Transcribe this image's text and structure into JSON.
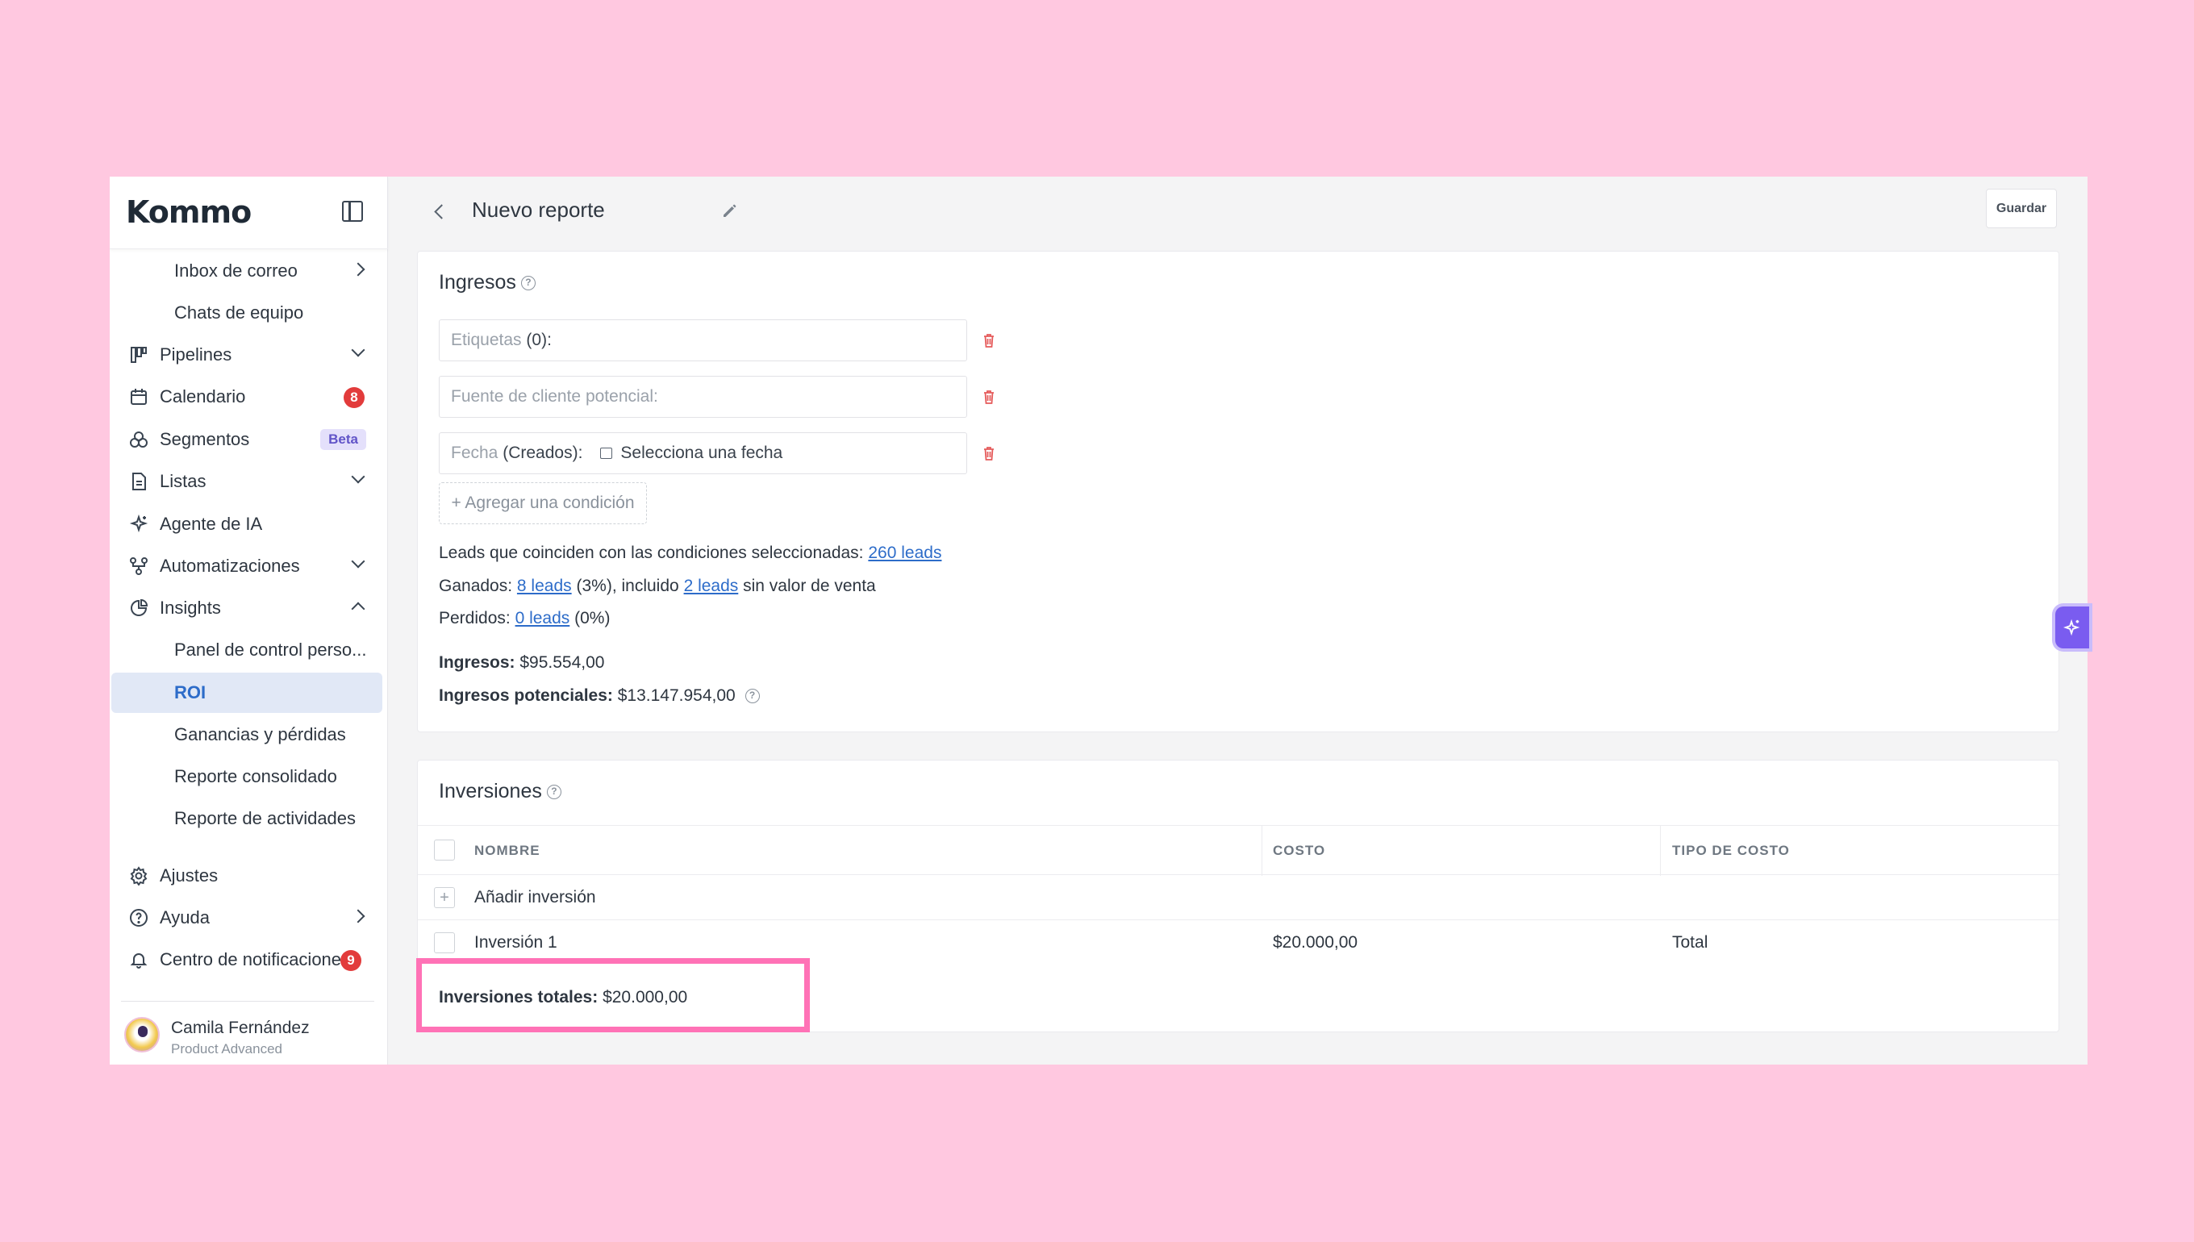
{
  "app": {
    "logo": "Kommo"
  },
  "sidebar": {
    "items": [
      {
        "label": "Inbox de correo",
        "icon": "none",
        "chevron": "right",
        "sub": true
      },
      {
        "label": "Chats de equipo",
        "icon": "none",
        "sub": true
      },
      {
        "label": "Pipelines",
        "icon": "pipelines-icon",
        "chevron": "down"
      },
      {
        "label": "Calendario",
        "icon": "calendar-icon",
        "badge": "8"
      },
      {
        "label": "Segmentos",
        "icon": "segments-icon",
        "beta": "Beta"
      },
      {
        "label": "Listas",
        "icon": "lists-icon",
        "chevron": "down"
      },
      {
        "label": "Agente de IA",
        "icon": "sparkle-icon"
      },
      {
        "label": "Automatizaciones",
        "icon": "automation-icon",
        "chevron": "down"
      },
      {
        "label": "Insights",
        "icon": "insights-icon",
        "chevron": "up"
      },
      {
        "label": "Panel de control perso...",
        "sub": true
      },
      {
        "label": "ROI",
        "sub": true,
        "active": true
      },
      {
        "label": "Ganancias y pérdidas",
        "sub": true
      },
      {
        "label": "Reporte consolidado",
        "sub": true
      },
      {
        "label": "Reporte de actividades",
        "sub": true
      }
    ],
    "bottom": [
      {
        "label": "Ajustes",
        "icon": "gear-icon"
      },
      {
        "label": "Ayuda",
        "icon": "help-icon",
        "chevron": "right"
      },
      {
        "label": "Centro de notificaciones",
        "icon": "bell-icon",
        "badge": "9"
      }
    ],
    "user": {
      "name": "Camila Fernández",
      "plan": "Product Advanced"
    }
  },
  "header": {
    "title": "Nuevo reporte",
    "save_label": "Guardar"
  },
  "ingresos": {
    "title": "Ingresos",
    "conditions": [
      {
        "label": "Etiquetas",
        "extra": "(0):"
      },
      {
        "label": "Fuente de cliente potencial:"
      },
      {
        "label": "Fecha",
        "extra": "(Creados):",
        "value": "Selecciona una fecha"
      }
    ],
    "add_condition": "+ Agregar una condición",
    "matching_text": "Leads que coinciden con las condiciones seleccionadas:",
    "matching_link": "260 leads",
    "won_prefix": "Ganados:",
    "won_link": "8 leads",
    "won_mid": "(3%), incluido",
    "won_link2": "2 leads",
    "won_suffix": "sin valor de venta",
    "lost_prefix": "Perdidos:",
    "lost_link": "0 leads",
    "lost_suffix": "(0%)",
    "revenue_label": "Ingresos:",
    "revenue_value": "$95.554,00",
    "potential_label": "Ingresos potenciales:",
    "potential_value": "$13.147.954,00"
  },
  "inversiones": {
    "title": "Inversiones",
    "columns": [
      "NOMBRE",
      "COSTO",
      "TIPO DE COSTO"
    ],
    "add_label": "Añadir inversión",
    "rows": [
      {
        "name": "Inversión 1",
        "cost": "$20.000,00",
        "type": "Total"
      }
    ],
    "total_label": "Inversiones totales:",
    "total_value": "$20.000,00"
  },
  "colors": {
    "accent": "#2d6cc9",
    "highlight": "#ff72b6",
    "background": "#ffc8e0",
    "badge": "#e23b3b"
  }
}
